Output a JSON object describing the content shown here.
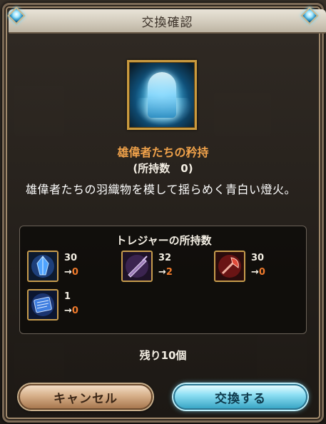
{
  "dialog": {
    "title": "交換確認"
  },
  "item": {
    "icon": "blue-flame-cloak-icon",
    "name": "雄偉者たちの矜持",
    "owned_line": "(所持数　0)",
    "description": "雄偉者たちの羽織物を模して揺らめく青白い燈火。"
  },
  "treasure_panel": {
    "title": "トレジャーの所持数",
    "items": [
      {
        "icon": "blue-crystal-icon",
        "before": "30",
        "arrow": "→",
        "after": "0"
      },
      {
        "icon": "dark-sword-icon",
        "before": "32",
        "arrow": "→",
        "after": "2"
      },
      {
        "icon": "red-axe-icon",
        "before": "30",
        "arrow": "→",
        "after": "0"
      },
      {
        "icon": "blue-scroll-icon",
        "before": "1",
        "arrow": "→",
        "after": "0"
      }
    ]
  },
  "remaining": "残り10個",
  "buttons": {
    "cancel": "キャンセル",
    "confirm": "交換する"
  },
  "colors": {
    "accent_orange": "#ef7a2c",
    "item_name": "#f0a24a"
  }
}
